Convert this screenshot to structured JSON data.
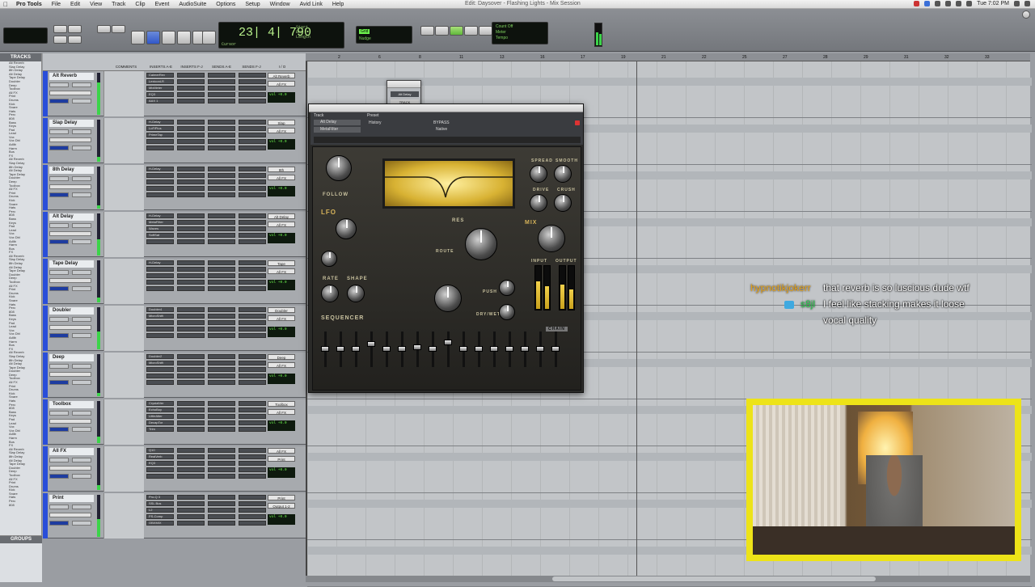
{
  "menubar": {
    "app_name": "Pro Tools",
    "items": [
      "File",
      "Edit",
      "View",
      "Track",
      "Clip",
      "Event",
      "AudioSuite",
      "Options",
      "Setup",
      "Window",
      "Avid Link",
      "Help"
    ],
    "window_title": "Edit: Daysover - Flashing Lights - Mix Session",
    "clock": "Tue 7:02 PM"
  },
  "transport": {
    "main_counter": "23| 4| 790",
    "counter_labels": [
      "Start",
      "End",
      "Length"
    ],
    "cursor_label": "Cursor",
    "grid_label": "Grid",
    "nudge_label": "Nudge",
    "tempo_label": "Tempo",
    "meter_label": "Meter",
    "count_off_label": "Count Off"
  },
  "tracklist": {
    "title": "TRACKS",
    "groups_title": "GROUPS",
    "items": [
      "Alt Reverb",
      "Slap Delay",
      "8th Delay",
      "Alt Delay",
      "Tape Delay",
      "Doubler",
      "Deep",
      "Toolbox",
      "All FX",
      "Print",
      "Drums",
      "Kick",
      "Snare",
      "Hats",
      "Perc",
      "808",
      "Bass",
      "Keys",
      "Pad",
      "Lead",
      "Vox",
      "Vox Dbl",
      "Adlib",
      "Harm",
      "Bus",
      "FX"
    ]
  },
  "mix": {
    "columns": [
      "COMMENTS",
      "INSERTS A-E",
      "INSERTS F-J",
      "SENDS A-E",
      "SENDS F-J",
      "I / O"
    ],
    "track_section_label": "TRACK",
    "strips": [
      {
        "name": "Alt Reverb",
        "io": "Alt Reverb",
        "out": "All FX",
        "vol": "vol +0.0",
        "inserts": [
          "CalmerRev",
          "LexiconLR",
          "MixMeter",
          "EQ3",
          "AAX 1"
        ]
      },
      {
        "name": "Slap Delay",
        "io": "Slap",
        "out": "All FX",
        "vol": "vol +0.0",
        "inserts": [
          "H-Delay",
          "LoFiPlus",
          "PrimeTap"
        ]
      },
      {
        "name": "8th Delay",
        "io": "8th",
        "out": "All FX",
        "vol": "vol +0.0",
        "inserts": [
          "H-Delay"
        ]
      },
      {
        "name": "Alt Delay",
        "io": "Alt Delay",
        "out": "All FX",
        "vol": "vol +0.0",
        "inserts": [
          "H-Delay",
          "MetaFilter",
          "Waves",
          "SoftSat"
        ]
      },
      {
        "name": "Tape Delay",
        "io": "Tape",
        "out": "All FX",
        "vol": "vol +0.0",
        "inserts": [
          "H-Delay"
        ]
      },
      {
        "name": "Doubler",
        "io": "Doubler",
        "out": "All FX",
        "vol": "vol +0.0",
        "inserts": [
          "Doubler4",
          "MicroShift"
        ]
      },
      {
        "name": "Deep",
        "io": "Deep",
        "out": "All FX",
        "vol": "vol +0.0",
        "inserts": [
          "Doubler2",
          "MicroShift"
        ]
      },
      {
        "name": "Toolbox",
        "io": "Toolbox",
        "out": "All FX",
        "vol": "vol +0.0",
        "inserts": [
          "CrystalVer",
          "EchoBoy",
          "LittleAlter",
          "DecapTor",
          "Trim"
        ]
      },
      {
        "name": "All FX",
        "io": "All FX",
        "out": "Print",
        "vol": "vol +0.0",
        "inserts": [
          "Q10",
          "RealVerb",
          "EQ3"
        ]
      },
      {
        "name": "Print",
        "io": "Print",
        "out": "Output 1-2",
        "vol": "vol +0.0",
        "inserts": [
          "Pro-Q 3",
          "SSL Bus",
          "L2",
          "PS-Comp",
          "OBXMIX"
        ]
      }
    ]
  },
  "plugin": {
    "track_label": "Track",
    "preset_label": "Preset",
    "track_value": "Alt Delay",
    "insert_value": "MetaFilter",
    "bypass_label": "BYPASS",
    "native_label": "Native",
    "history_label": "History",
    "labels": {
      "follow": "FOLLOW",
      "lfo": "LFO",
      "rate": "RATE",
      "shape": "SHAPE",
      "sequencer": "SEQUENCER",
      "res": "RES",
      "route": "ROUTE",
      "spread": "SPREAD",
      "smooth": "SMOOTH",
      "drive": "DRIVE",
      "crush": "CRUSH",
      "mix": "MIX",
      "input": "INPUT",
      "output": "OUTPUT",
      "push": "PUSH",
      "drywet": "DRY/WET",
      "chain": "CHAIN"
    }
  },
  "mini_strip": {
    "name": "Alt Delay",
    "auto_label": "AUTO",
    "track_label": "TRACK",
    "vol": "+0.0"
  },
  "chat": [
    {
      "user": "hypnotikjokerr",
      "user_color": "#e8a419",
      "message": "that reverb is so luscious dude wtf"
    },
    {
      "user": "s8jl",
      "user_color": "#27c94a",
      "message": "I feel like stacking makes it loose",
      "continuation": "vocal quality"
    }
  ],
  "ruler_marks": [
    "2",
    "6",
    "8",
    "11",
    "13",
    "16",
    "17",
    "19",
    "21",
    "22",
    "25",
    "27",
    "28",
    "29",
    "31",
    "32",
    "33"
  ],
  "colors": {
    "accent": "#2a4ed9",
    "meter_green": "#3cd44a",
    "webcam_border": "#ede318"
  }
}
